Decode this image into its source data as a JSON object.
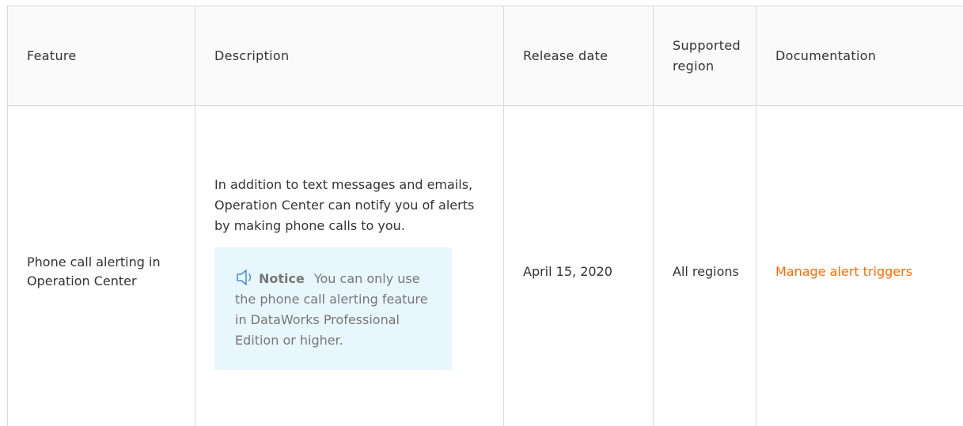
{
  "table": {
    "headers": {
      "feature": "Feature",
      "description": "Description",
      "release_date": "Release date",
      "supported_region": "Supported region",
      "documentation": "Documentation"
    },
    "rows": [
      {
        "feature": "Phone call alerting in Operation Center",
        "description": "In addition to text messages and emails, Operation Center can notify you of alerts by making phone calls to you.",
        "notice": {
          "icon": "speaker-icon",
          "label": "Notice",
          "text": "You can only use the phone call alerting feature in DataWorks Professional Edition or higher."
        },
        "release_date": "April 15, 2020",
        "supported_region": "All regions",
        "documentation": "Manage alert triggers"
      }
    ]
  },
  "colors": {
    "link": "#ff6a00",
    "notice_background": "#e8f6fe",
    "notice_icon": "#4a90d9",
    "border": "#d9d9d9"
  }
}
